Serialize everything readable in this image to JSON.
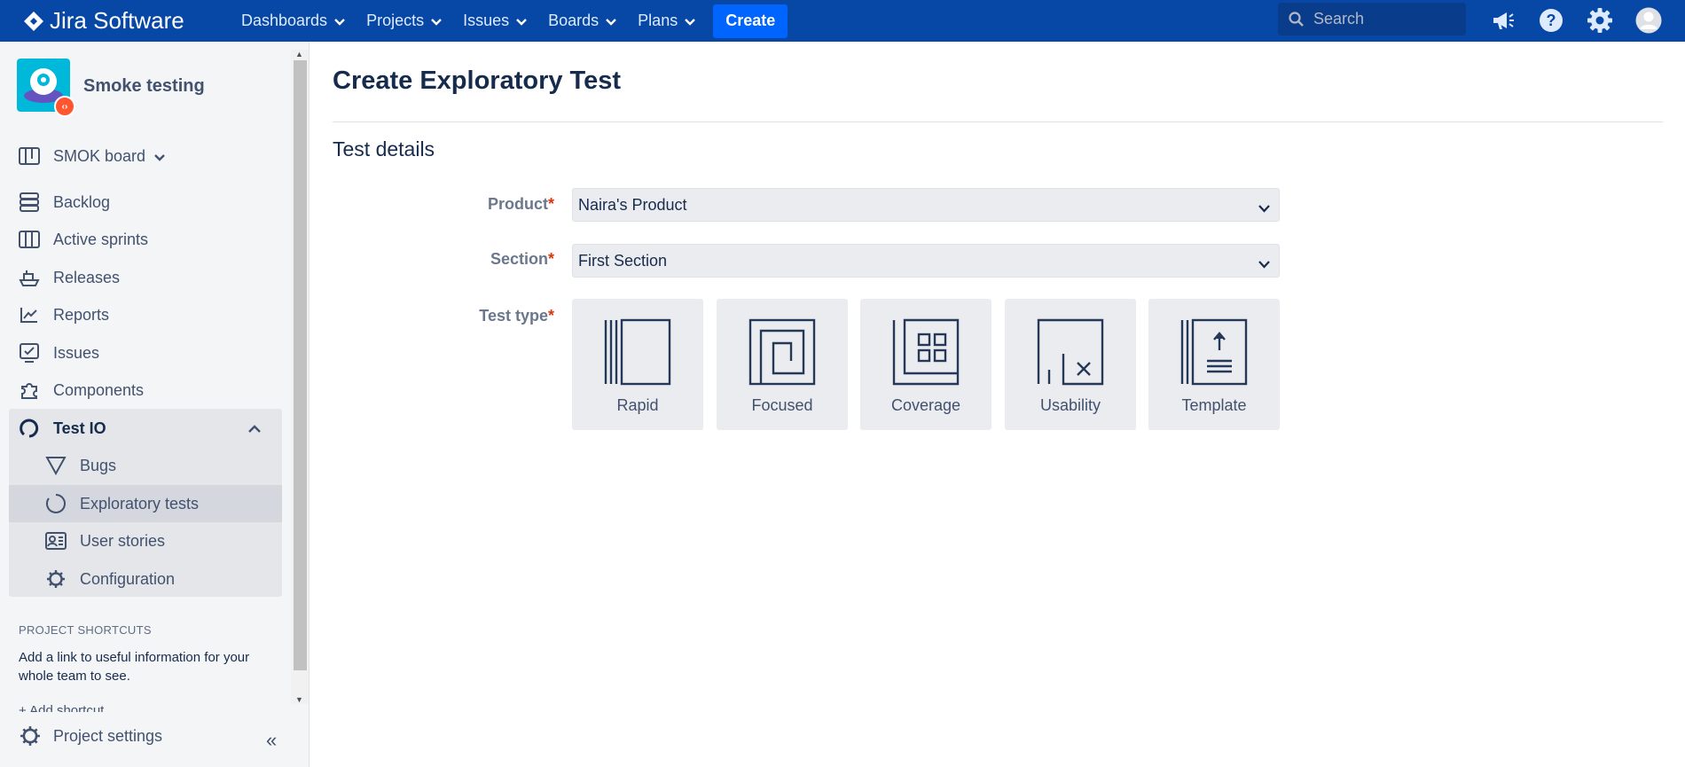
{
  "app": {
    "name": "Jira Software"
  },
  "topnav": {
    "items": [
      "Dashboards",
      "Projects",
      "Issues",
      "Boards",
      "Plans"
    ],
    "create_label": "Create",
    "search_placeholder": "Search"
  },
  "sidebar": {
    "project_name": "Smoke testing",
    "board_label": "SMOK board",
    "items": [
      "Backlog",
      "Active sprints",
      "Releases",
      "Reports",
      "Issues",
      "Components"
    ],
    "test_io": {
      "label": "Test IO",
      "items": [
        "Bugs",
        "Exploratory tests",
        "User stories",
        "Configuration"
      ]
    },
    "shortcuts_title": "PROJECT SHORTCUTS",
    "shortcuts_text": "Add a link to useful information for your whole team to see.",
    "shortcut_cut_text": "Add shortcut",
    "project_settings": "Project settings"
  },
  "main": {
    "title": "Create Exploratory Test",
    "section_title": "Test details",
    "product": {
      "label": "Product",
      "required": "*",
      "value": "Naira's Product"
    },
    "section": {
      "label": "Section",
      "required": "*",
      "value": "First Section"
    },
    "test_type": {
      "label": "Test type",
      "required": "*",
      "options": [
        "Rapid",
        "Focused",
        "Coverage",
        "Usability",
        "Template"
      ]
    }
  },
  "colors": {
    "nav_bg": "#0747a6",
    "create_bg": "#0065ff",
    "sidebar_bg": "#f4f5f7",
    "required": "#de350b"
  }
}
